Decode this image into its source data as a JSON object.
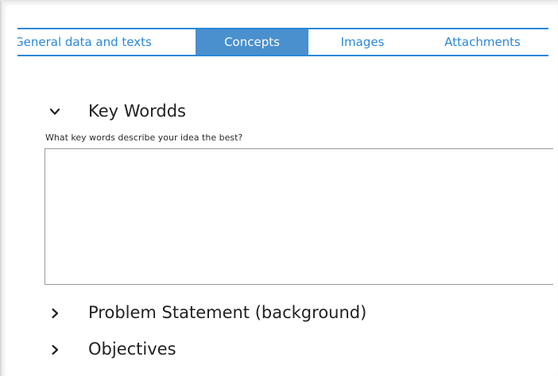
{
  "tabs": [
    {
      "label": "General data and texts",
      "active": false
    },
    {
      "label": "Concepts",
      "active": true
    },
    {
      "label": "Images",
      "active": false
    },
    {
      "label": "Attachments",
      "active": false
    }
  ],
  "sections": {
    "key_words": {
      "title": "Key Wordds",
      "expanded": true,
      "chevron_icon": "chevron-down-icon",
      "field_label": "What key words describe your idea the best?",
      "field_value": ""
    },
    "problem_statement": {
      "title": "Problem Statement (background)",
      "expanded": false,
      "chevron_icon": "chevron-right-icon"
    },
    "objectives": {
      "title": "Objectives",
      "expanded": false,
      "chevron_icon": "chevron-right-icon"
    }
  },
  "colors": {
    "accent": "#2b88d8",
    "active_tab_bg": "#4a8fce",
    "active_tab_text": "#ffffff"
  }
}
